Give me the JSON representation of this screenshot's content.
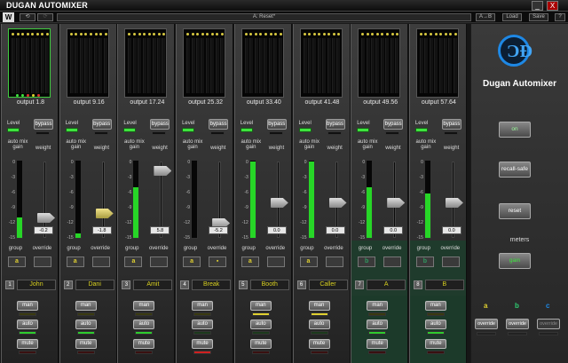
{
  "window": {
    "title": "DUGAN AUTOMIXER",
    "minimize": "_",
    "close": "X"
  },
  "toolbar": {
    "logo": "W",
    "undo": "⟲",
    "redo": "⟳",
    "preset": "A: Reset*",
    "ab": "A→B",
    "load": "Load",
    "save": "Save",
    "help": "?"
  },
  "labels": {
    "level": "Level",
    "bypass": "bypass",
    "auto_mix_gain": "auto mix gain",
    "weight": "weight",
    "group": "group",
    "override": "override",
    "man": "man",
    "auto": "auto",
    "mute": "mute"
  },
  "scale": [
    "0",
    "-3",
    "-6",
    "-9",
    "-12",
    "-15"
  ],
  "channels": [
    {
      "num": "1",
      "name": "John",
      "output": "output 1.8",
      "weight": "-0.2",
      "group": "a",
      "group_color": "#e0d030",
      "override": "",
      "gain_pct": 26,
      "knob_pct": 27,
      "active": true,
      "man_led": "#3a3a10",
      "auto_led": "#2ecc2e",
      "mute_led": "#3a1010",
      "knob_sel": false
    },
    {
      "num": "2",
      "name": "Dani",
      "output": "output 9.16",
      "weight": "-1.8",
      "group": "a",
      "group_color": "#e0d030",
      "override": "",
      "gain_pct": 6,
      "knob_pct": 33,
      "active": false,
      "man_led": "#3a3a10",
      "auto_led": "#2ecc2e",
      "mute_led": "#3a1010",
      "knob_sel": true
    },
    {
      "num": "3",
      "name": "Amit",
      "output": "output 17.24",
      "weight": "5.8",
      "group": "a",
      "group_color": "#e0d030",
      "override": "",
      "gain_pct": 66,
      "knob_pct": 88,
      "active": false,
      "man_led": "#3a3a10",
      "auto_led": "#2ecc2e",
      "mute_led": "#3a1010",
      "knob_sel": false
    },
    {
      "num": "4",
      "name": "Break",
      "output": "output 25.32",
      "weight": "-5.2",
      "group": "a",
      "group_color": "#e0d030",
      "override": "▪",
      "gain_pct": 0,
      "knob_pct": 20,
      "active": false,
      "man_led": "#3a3a10",
      "auto_led": "#1c3a1c",
      "mute_led": "#d02020",
      "knob_sel": false
    },
    {
      "num": "5",
      "name": "Booth",
      "output": "output 33.40",
      "weight": "0.0",
      "group": "a",
      "group_color": "#e0d030",
      "override": "",
      "gain_pct": 99,
      "knob_pct": 47,
      "active": false,
      "man_led": "#e0d030",
      "auto_led": "#1c3a1c",
      "mute_led": "#3a1010",
      "knob_sel": false
    },
    {
      "num": "6",
      "name": "Caller",
      "output": "output 41.48",
      "weight": "0.0",
      "group": "a",
      "group_color": "#e0d030",
      "override": "",
      "gain_pct": 99,
      "knob_pct": 47,
      "active": false,
      "man_led": "#e0d030",
      "auto_led": "#1c3a1c",
      "mute_led": "#3a1010",
      "knob_sel": false
    },
    {
      "num": "7",
      "name": "A",
      "output": "output 49.56",
      "weight": "0.0",
      "group": "b",
      "group_color": "#2e9a60",
      "override": "",
      "gain_pct": 66,
      "knob_pct": 47,
      "active": false,
      "man_led": "#3a3a10",
      "auto_led": "#2ecc2e",
      "mute_led": "#3a1010",
      "knob_sel": false
    },
    {
      "num": "8",
      "name": "B",
      "output": "output 57.64",
      "weight": "0.0",
      "group": "b",
      "group_color": "#2e9a60",
      "override": "",
      "gain_pct": 58,
      "knob_pct": 47,
      "active": false,
      "man_led": "#3a3a10",
      "auto_led": "#2ecc2e",
      "mute_led": "#3a1010",
      "knob_sel": false
    }
  ],
  "side": {
    "logo": "ƆĐ",
    "brand": "Dugan Automixer",
    "on": "on",
    "recall_safe": "recall-safe",
    "reset": "reset",
    "meters": "meters",
    "gain": "gain",
    "groups": [
      {
        "letter": "a",
        "color": "#e0d030",
        "override": "override",
        "disabled": false
      },
      {
        "letter": "b",
        "color": "#2ecc71",
        "override": "override",
        "disabled": false
      },
      {
        "letter": "c",
        "color": "#1e88e5",
        "override": "override",
        "disabled": true
      }
    ]
  }
}
